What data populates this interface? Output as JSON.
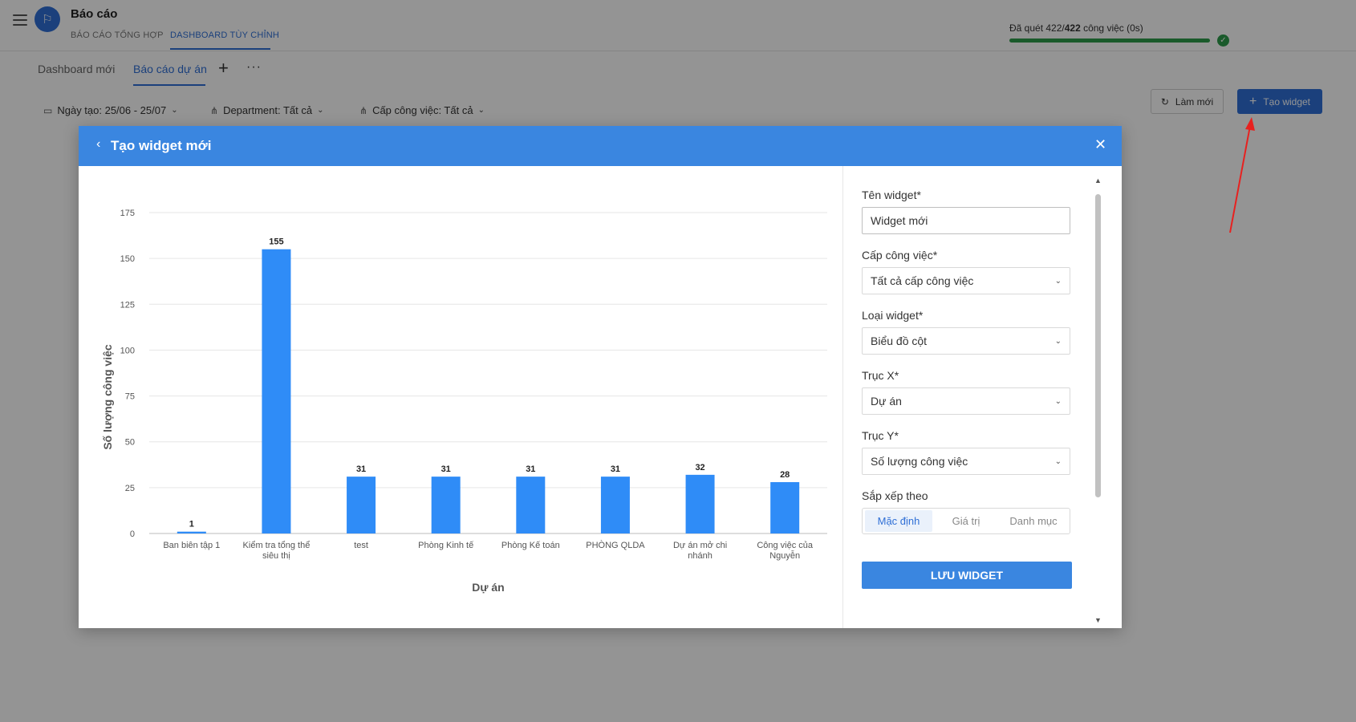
{
  "app": {
    "title": "Báo cáo",
    "logo_icon": "flag-icon",
    "tabs": [
      {
        "label": "BÁO CÁO TỔNG HỢP",
        "active": false
      },
      {
        "label": "DASHBOARD TÙY CHỈNH",
        "active": true
      }
    ],
    "scan": {
      "prefix": "Đã quét 422/",
      "bold": "422",
      "suffix": " công việc (0s)",
      "progress": 1.0,
      "color": "#2e9c4a"
    }
  },
  "dashboard_tabs": [
    {
      "label": "Dashboard mới",
      "active": false
    },
    {
      "label": "Báo cáo dự án",
      "active": true
    }
  ],
  "filters": {
    "date": "Ngày tạo: 25/06 - 25/07",
    "department": "Department: Tất cả",
    "level": "Cấp công việc: Tất cả"
  },
  "actions": {
    "refresh": "Làm mới",
    "create": "Tạo widget"
  },
  "modal": {
    "title": "Tạo widget mới",
    "header_color": "#3a86e0",
    "form": {
      "name_label": "Tên widget*",
      "name_value": "Widget mới",
      "level_label": "Cấp công việc*",
      "level_value": "Tất cả cấp công việc",
      "type_label": "Loại widget*",
      "type_value": "Biểu đồ cột",
      "x_label": "Trục X*",
      "x_value": "Dự án",
      "y_label": "Trục Y*",
      "y_value": "Số lượng công việc",
      "sort_label": "Sắp xếp theo",
      "sort_options": [
        "Mặc định",
        "Giá trị",
        "Danh mục"
      ],
      "sort_selected": "Mặc định",
      "save": "LƯU WIDGET"
    }
  },
  "chart_data": {
    "type": "bar",
    "categories": [
      [
        "Ban biên tập 1"
      ],
      [
        "Kiểm tra tổng thể",
        "siêu thị"
      ],
      [
        "test"
      ],
      [
        "Phòng Kinh tế"
      ],
      [
        "Phòng Kế toán"
      ],
      [
        "PHÒNG QLDA"
      ],
      [
        "Dự án mở chi",
        "nhánh"
      ],
      [
        "Công việc của",
        "Nguyễn"
      ]
    ],
    "values": [
      1,
      155,
      31,
      31,
      31,
      31,
      32,
      28
    ],
    "xlabel": "Dự án",
    "ylabel": "Số lượng công việc",
    "ylim": [
      0,
      175
    ],
    "yticks": [
      0,
      25,
      50,
      75,
      100,
      125,
      150,
      175
    ],
    "grid": true,
    "bar_color": "#2f8cf7"
  }
}
